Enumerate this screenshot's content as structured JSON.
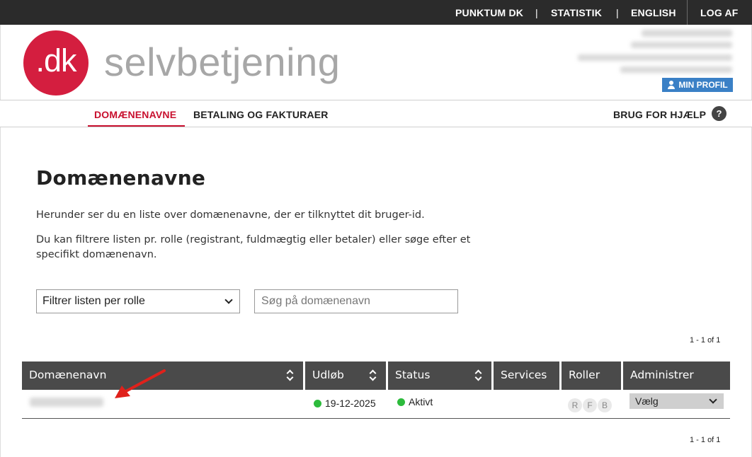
{
  "topbar": {
    "links": [
      "PUNKTUM DK",
      "STATISTIK",
      "ENGLISH"
    ],
    "separator": "|",
    "logout": "LOG AF"
  },
  "header": {
    "logo_text": ".dk",
    "brand": "selvbetjening",
    "profile_button": "MIN PROFIL"
  },
  "nav": {
    "items": [
      "DOMÆNENAVNE",
      "BETALING OG FAKTURAER"
    ],
    "active_index": 0,
    "help_label": "BRUG FOR HJÆLP",
    "help_icon_glyph": "?"
  },
  "page": {
    "title": "Domænenavne",
    "intro1": "Herunder ser du en liste over domænenavne, der er tilknyttet dit bruger-id.",
    "intro2_line1": "Du kan filtrere listen pr. rolle (registrant, fuldmægtig eller betaler) eller søge efter et",
    "intro2_line2": "specifikt domænenavn."
  },
  "filters": {
    "role_select": "Filtrer listen per rolle",
    "search_placeholder": "Søg på domænenavn"
  },
  "pager": {
    "top": "1 - 1 of 1",
    "bottom": "1 - 1 of 1"
  },
  "table": {
    "headers": [
      "Domænenavn",
      "Udløb",
      "Status",
      "Services",
      "Roller",
      "Administrer"
    ],
    "rows": [
      {
        "domain": "",
        "expiry": "19-12-2025",
        "status": "Aktivt",
        "roles": [
          "R",
          "F",
          "B"
        ],
        "action": "Vælg"
      }
    ]
  },
  "colors": {
    "topbar": "#2b2b2b",
    "brand_red": "#d41e3f",
    "nav_active": "#c8102e",
    "profile_blue": "#3a80c6",
    "table_header": "#4a4a4a",
    "status_green": "#2dbb3c"
  }
}
